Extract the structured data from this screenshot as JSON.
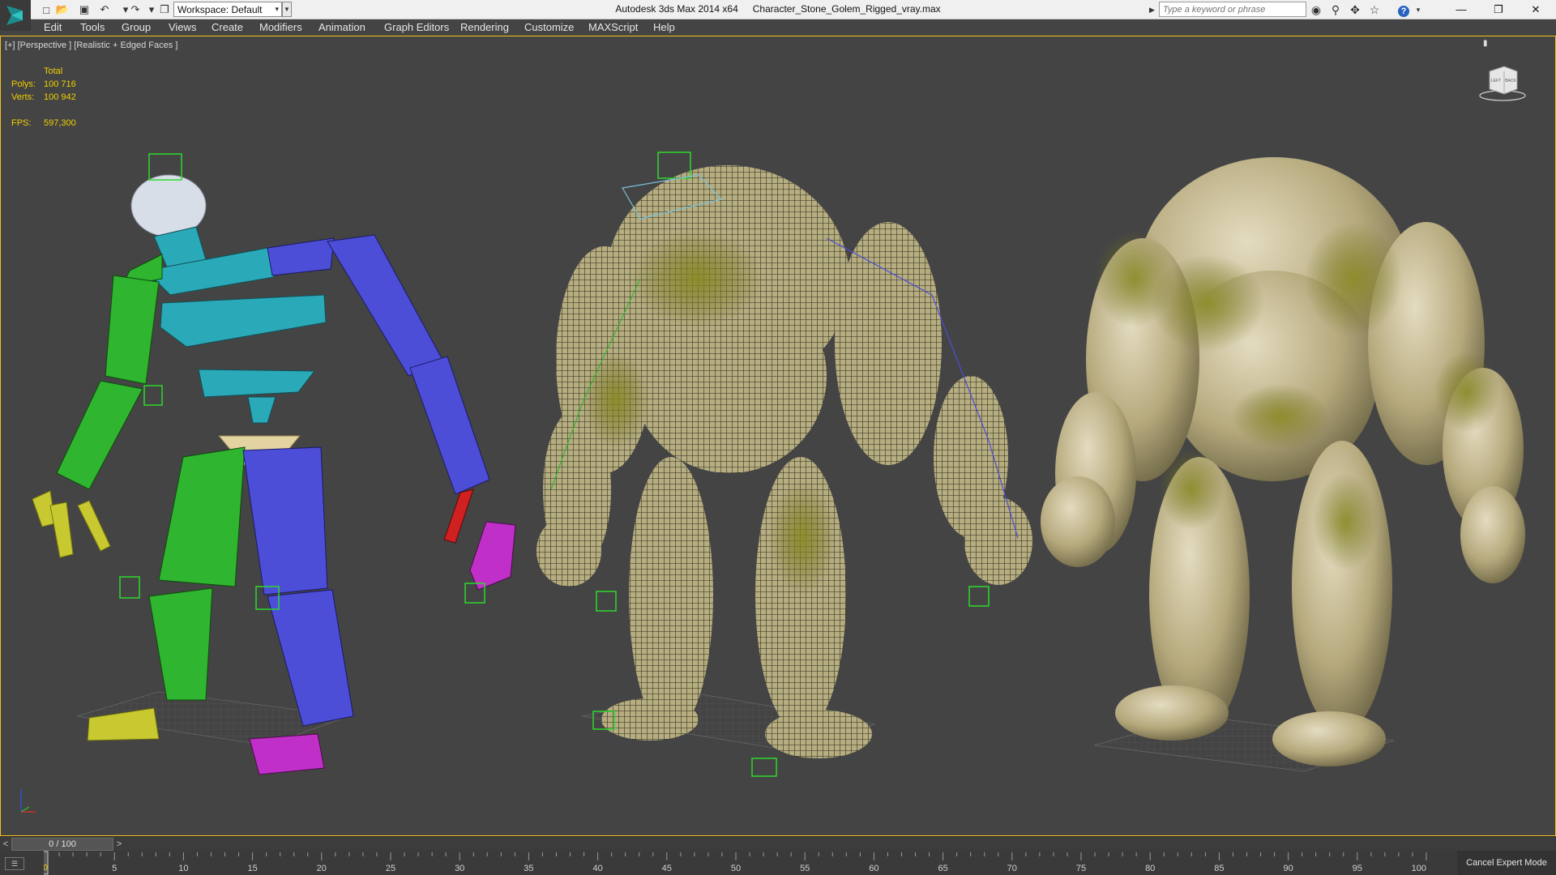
{
  "title_bar": {
    "workspace_label": "Workspace: Default",
    "app_name": "Autodesk 3ds Max  2014 x64",
    "file_name": "Character_Stone_Golem_Rigged_vray.max",
    "search_placeholder": "Type a keyword or phrase",
    "quick_access_icons": [
      "new-file-icon",
      "open-file-icon",
      "save-icon",
      "undo-icon",
      "redo-icon",
      "project-folder-icon"
    ],
    "toolbar_icons": [
      "binoculars-icon",
      "key-search-icon",
      "communication-center-icon",
      "favorites-star-icon",
      "help-icon"
    ]
  },
  "menu": {
    "items": [
      {
        "label": "Edit"
      },
      {
        "label": "Tools"
      },
      {
        "label": "Group"
      },
      {
        "label": "Views"
      },
      {
        "label": "Create"
      },
      {
        "label": "Modifiers"
      },
      {
        "label": "Animation"
      },
      {
        "label": "Graph Editors"
      },
      {
        "label": "Rendering"
      },
      {
        "label": "Customize"
      },
      {
        "label": "MAXScript"
      },
      {
        "label": "Help"
      }
    ]
  },
  "viewport": {
    "label": "[+] [Perspective ] [Realistic + Edged Faces ]",
    "stats": {
      "header": "Total",
      "polys_label": "Polys:",
      "polys_value": "100 716",
      "verts_label": "Verts:",
      "verts_value": "100 942",
      "fps_label": "FPS:",
      "fps_value": "597,300"
    },
    "colors": {
      "background": "#444444",
      "active_border": "#f0c020",
      "stats_text": "#f0d000",
      "bone_green": "#2fb52f",
      "bone_cyan": "#2aa9b8",
      "bone_blue": "#4d4ed8",
      "bone_red": "#d02020",
      "bone_magenta": "#c030c8",
      "bone_yellow": "#c8c830",
      "stone": "#c4b88a",
      "moss": "#7a7a1e"
    },
    "navcube_labels": [
      "LEFT",
      "BACK"
    ]
  },
  "time_slider": {
    "label": "0 / 100",
    "current_frame": 0,
    "total_frames": 100
  },
  "track_bar": {
    "ticks": [
      5,
      10,
      15,
      20,
      25,
      30,
      35,
      40,
      45,
      50,
      55,
      60,
      65,
      70,
      75,
      80,
      85,
      90,
      95,
      100
    ],
    "cancel_label": "Cancel Expert Mode"
  }
}
